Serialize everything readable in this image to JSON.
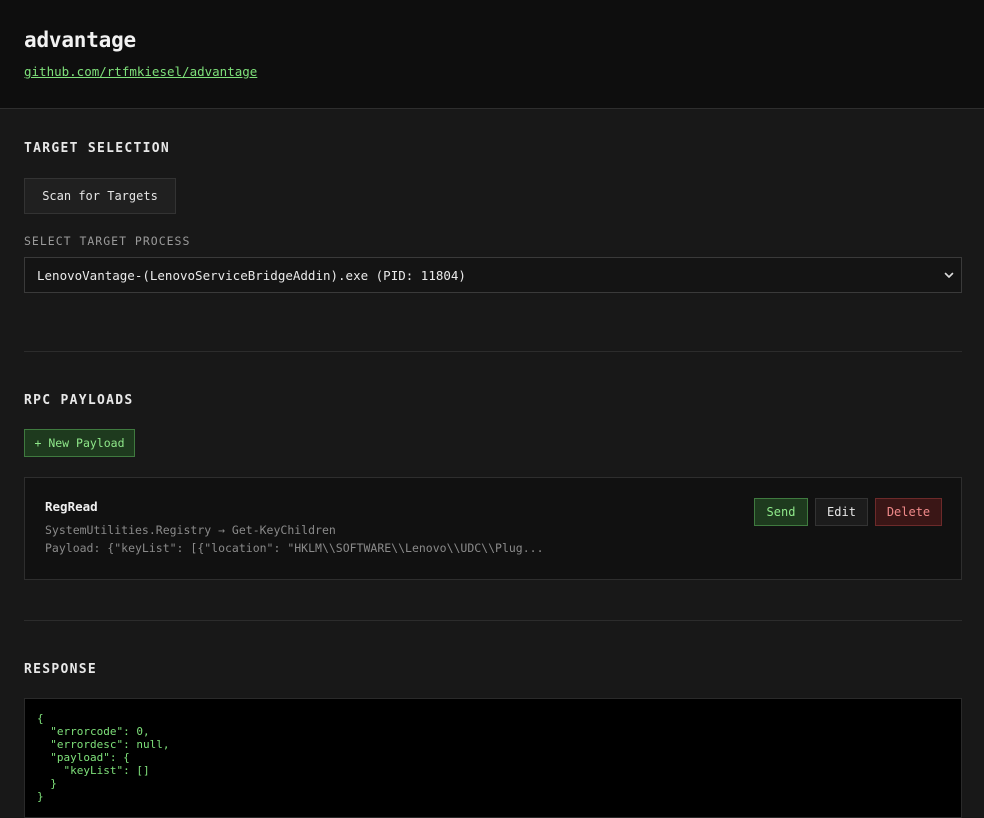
{
  "header": {
    "title": "advantage",
    "repo_link": "github.com/rtfmkiesel/advantage"
  },
  "target_selection": {
    "title": "TARGET SELECTION",
    "scan_button": "Scan for Targets",
    "select_label": "SELECT TARGET PROCESS",
    "selected_process": "LenovoVantage-(LenovoServiceBridgeAddin).exe (PID: 11804)"
  },
  "rpc_payloads": {
    "title": "RPC PAYLOADS",
    "new_button": "+ New Payload",
    "items": [
      {
        "name": "RegRead",
        "method": "SystemUtilities.Registry → Get-KeyChildren",
        "preview": "Payload: {\"keyList\": [{\"location\": \"HKLM\\\\SOFTWARE\\\\Lenovo\\\\UDC\\\\Plug...",
        "send_label": "Send",
        "edit_label": "Edit",
        "delete_label": "Delete"
      }
    ]
  },
  "response": {
    "title": "RESPONSE",
    "body": "{\n  \"errorcode\": 0,\n  \"errordesc\": null,\n  \"payload\": {\n    \"keyList\": []\n  }\n}"
  },
  "colors": {
    "accent_green": "#7ee07a",
    "danger_red": "#f08a8a",
    "background": "#181818"
  },
  "icons": {
    "select_chevron": "chevron-down-icon"
  }
}
